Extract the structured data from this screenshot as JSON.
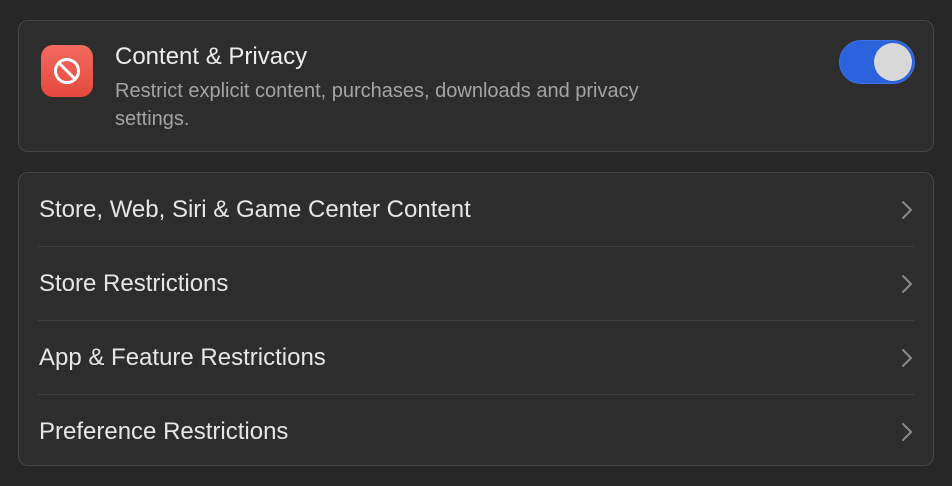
{
  "header": {
    "title": "Content & Privacy",
    "description": "Restrict explicit content, purchases, downloads and privacy settings.",
    "icon": "restriction-icon",
    "toggle_on": true,
    "accent_color": "#2a63dc",
    "icon_color": "#e4493f"
  },
  "rows": [
    {
      "label": "Store, Web, Siri & Game Center Content"
    },
    {
      "label": "Store Restrictions"
    },
    {
      "label": "App & Feature Restrictions"
    },
    {
      "label": "Preference Restrictions"
    }
  ]
}
